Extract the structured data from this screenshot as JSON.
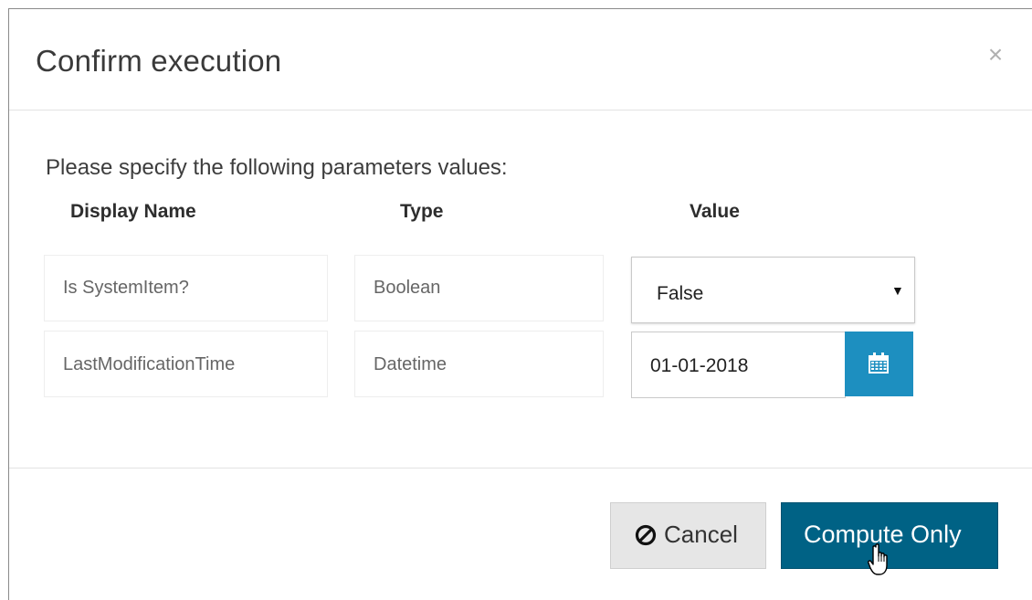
{
  "dialog": {
    "title": "Confirm execution",
    "close_symbol": "×"
  },
  "body": {
    "intro": "Please specify the following parameters values:",
    "columns": {
      "display_name": "Display Name",
      "type": "Type",
      "value": "Value"
    },
    "rows": [
      {
        "display_name": "Is SystemItem?",
        "type": "Boolean",
        "value": "False",
        "control": "select"
      },
      {
        "display_name": "LastModificationTime",
        "type": "Datetime",
        "value": "01-01-2018",
        "control": "date"
      }
    ],
    "select_arrow": "▼",
    "calendar_icon": "calendar-icon"
  },
  "footer": {
    "cancel_label": "Cancel",
    "cancel_icon": "ban-icon",
    "compute_label": "Compute Only"
  },
  "colors": {
    "primary": "#006285",
    "calendar_button": "#1d8fc0",
    "cancel_bg": "#e6e6e6"
  }
}
